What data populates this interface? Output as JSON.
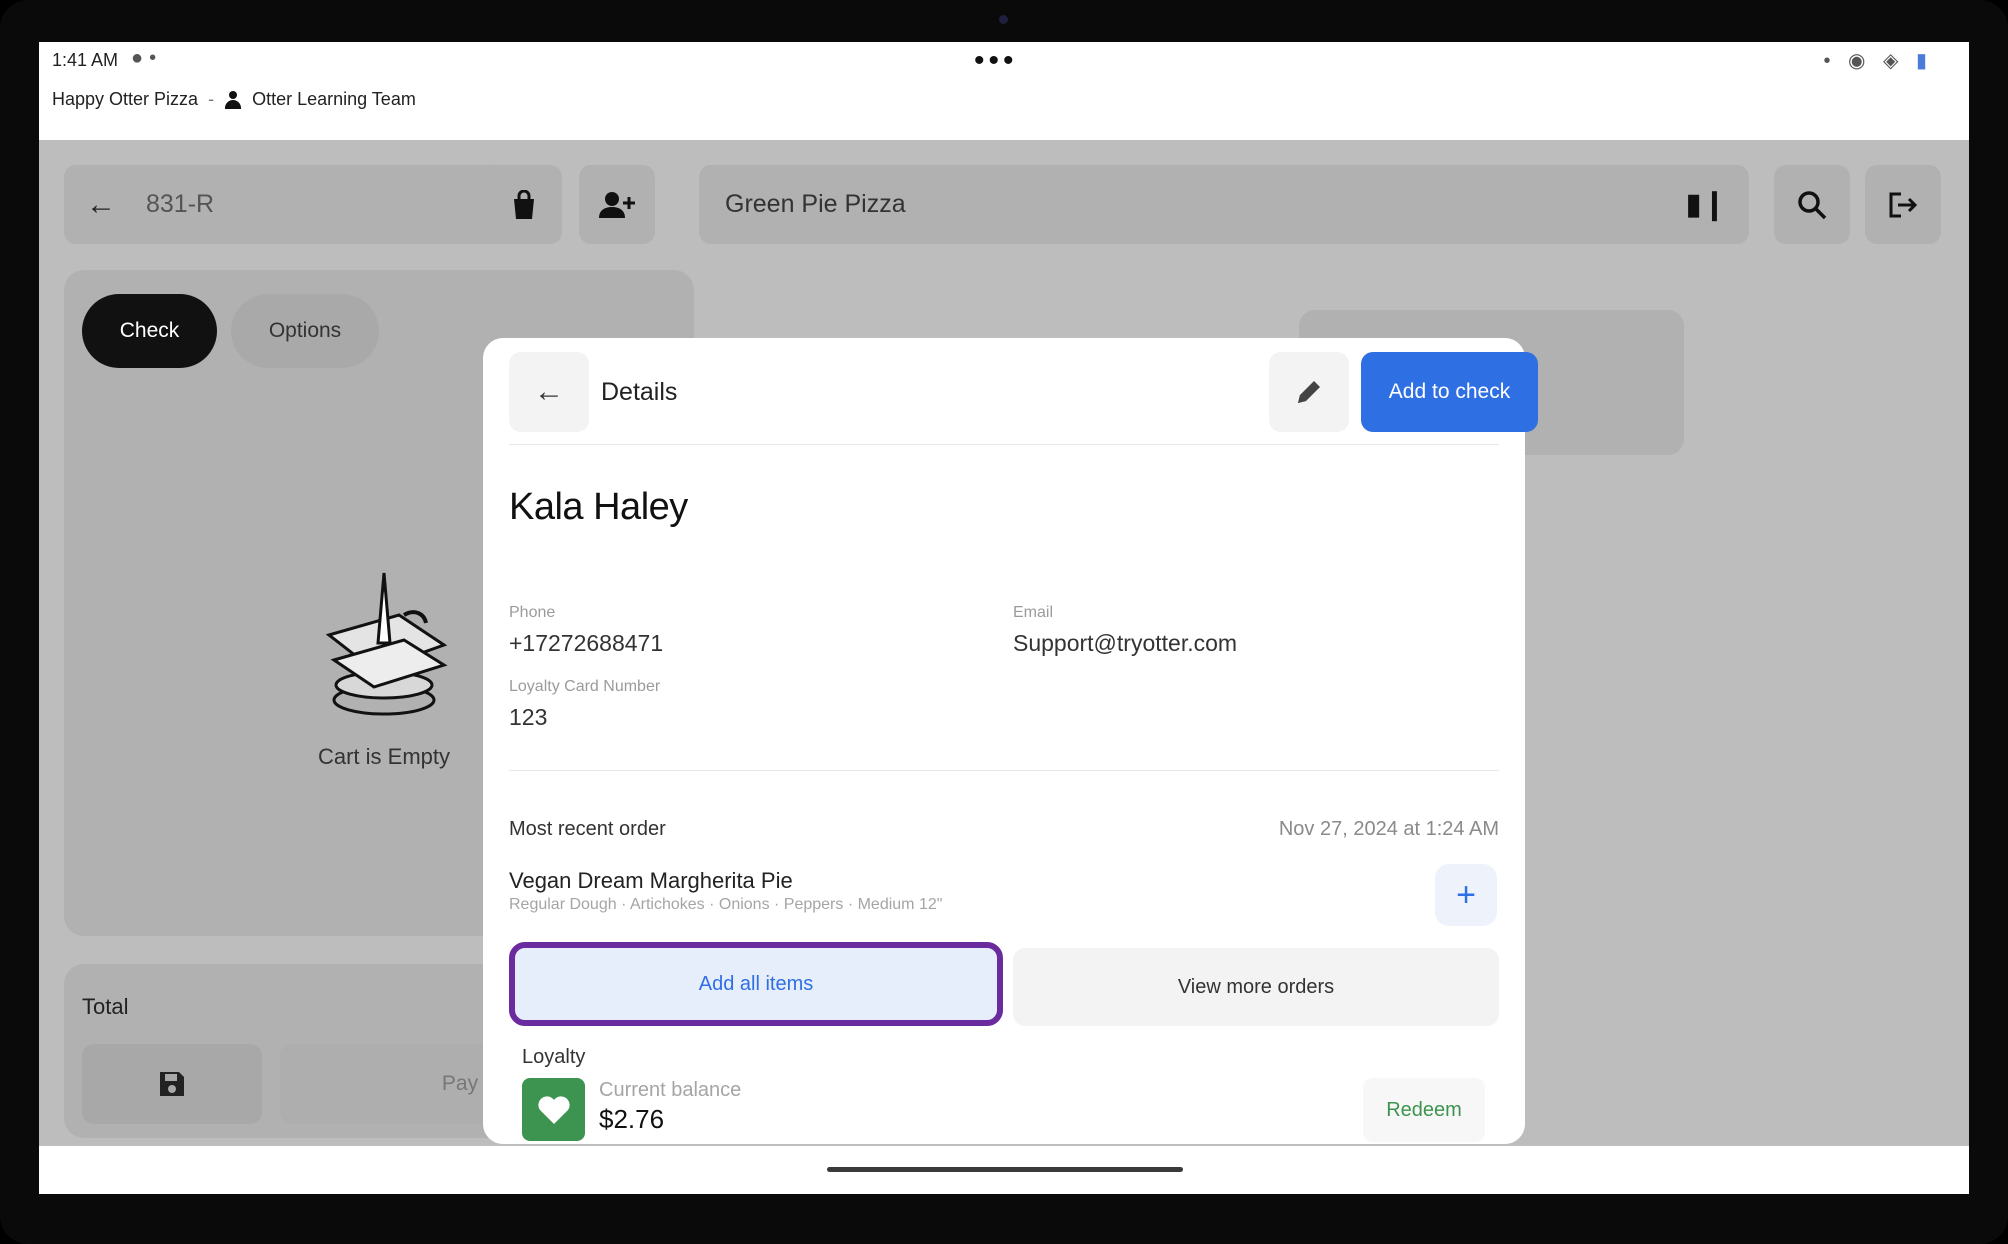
{
  "status_bar": {
    "time": "1:41 AM"
  },
  "header": {
    "store": "Happy Otter Pizza",
    "separator": "-",
    "team": "Otter Learning Team"
  },
  "order_bar": {
    "order_code": "831-R"
  },
  "store_bar": {
    "store_name": "Green Pie Pizza"
  },
  "left_panel": {
    "tabs": [
      {
        "label": "Check"
      },
      {
        "label": "Options"
      }
    ],
    "cart_empty": "Cart is Empty"
  },
  "total_panel": {
    "total_label": "Total",
    "pay_label": "Pay"
  },
  "modal": {
    "title": "Details",
    "add_to_check": "Add to check",
    "customer_name": "Kala Haley",
    "phone_label": "Phone",
    "phone": "+17272688471",
    "email_label": "Email",
    "email": "Support@tryotter.com",
    "loyalty_card_label": "Loyalty Card Number",
    "loyalty_card": "123",
    "recent_order_label": "Most recent order",
    "recent_order_date": "Nov 27, 2024 at 1:24 AM",
    "item_name": "Vegan Dream Margherita Pie",
    "item_modifiers": "Regular Dough · Artichokes · Onions · Peppers · Medium 12\"",
    "add_all_label": "Add all items",
    "view_more_label": "View more orders",
    "loyalty_title": "Loyalty",
    "balance_label": "Current balance",
    "balance": "$2.76",
    "redeem_label": "Redeem"
  },
  "colors": {
    "primary": "#2f6fe4",
    "loyalty_green": "#3d9350",
    "highlight": "#6a2b9e"
  }
}
